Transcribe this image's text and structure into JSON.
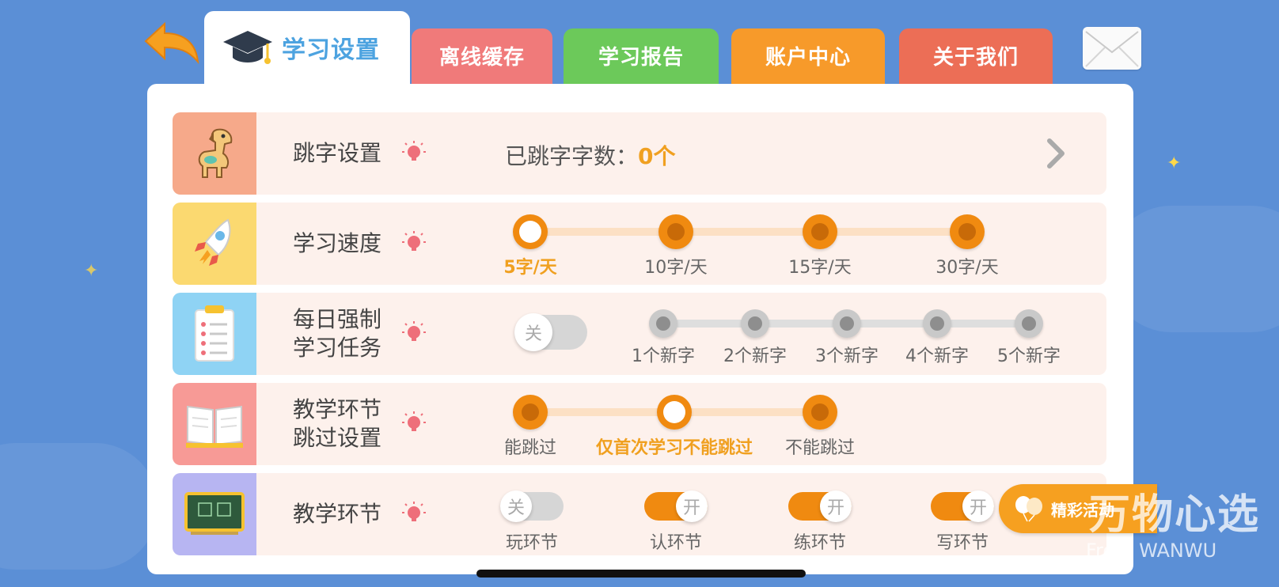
{
  "tabs": [
    {
      "label": "学习设置",
      "icon": "graduation-cap-icon",
      "active": true
    },
    {
      "label": "离线缓存",
      "color": "#f07a7a"
    },
    {
      "label": "学习报告",
      "color": "#6cc95a"
    },
    {
      "label": "账户中心",
      "color": "#f79a2a"
    },
    {
      "label": "关于我们",
      "color": "#ec6e56"
    }
  ],
  "settings": {
    "skip": {
      "label": "跳字设置",
      "count_label": "已跳字字数：",
      "count_value": "0个"
    },
    "speed": {
      "label": "学习速度",
      "options": [
        "5字/天",
        "10字/天",
        "15字/天",
        "30字/天"
      ],
      "selected": "5字/天"
    },
    "daily_task": {
      "label_line1": "每日强制",
      "label_line2": "学习任务",
      "toggle": "关",
      "options": [
        "1个新字",
        "2个新字",
        "3个新字",
        "4个新字",
        "5个新字"
      ]
    },
    "skip_steps": {
      "label_line1": "教学环节",
      "label_line2": "跳过设置",
      "options": [
        "能跳过",
        "仅首次学习不能跳过",
        "不能跳过"
      ],
      "selected": "仅首次学习不能跳过"
    },
    "steps": {
      "label": "教学环节",
      "items": [
        {
          "name": "玩环节",
          "state": "关"
        },
        {
          "name": "认环节",
          "state": "开"
        },
        {
          "name": "练环节",
          "state": "开"
        },
        {
          "name": "写环节",
          "state": "开"
        }
      ]
    }
  },
  "activity_button": "精彩活动",
  "watermark": "万物心选",
  "watermark_sub": "From WANWU",
  "colors": {
    "background": "#5b8fd6",
    "accent": "#f08a10",
    "selected_text": "#f0a020",
    "tab_active_text": "#4da3e0"
  }
}
